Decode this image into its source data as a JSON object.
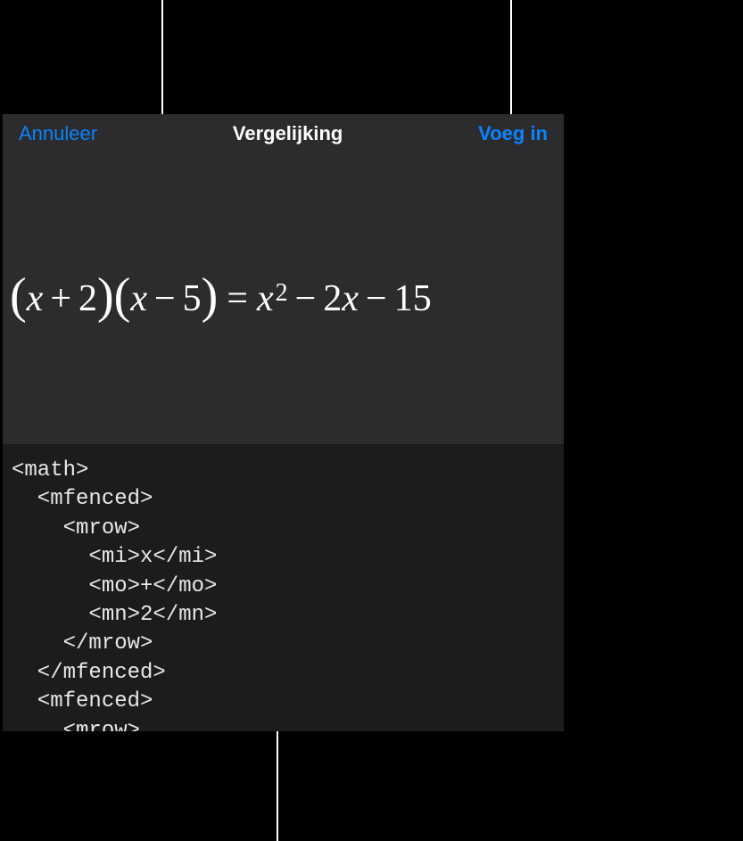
{
  "header": {
    "cancel_label": "Annuleer",
    "title": "Vergelijking",
    "insert_label": "Voeg in"
  },
  "equation": {
    "display": "(x + 2)(x − 5) = x² − 2x − 15"
  },
  "code": {
    "text": "<math>\n  <mfenced>\n    <mrow>\n      <mi>x</mi>\n      <mo>+</mo>\n      <mn>2</mn>\n    </mrow>\n  </mfenced>\n  <mfenced>\n    <mrow>"
  }
}
